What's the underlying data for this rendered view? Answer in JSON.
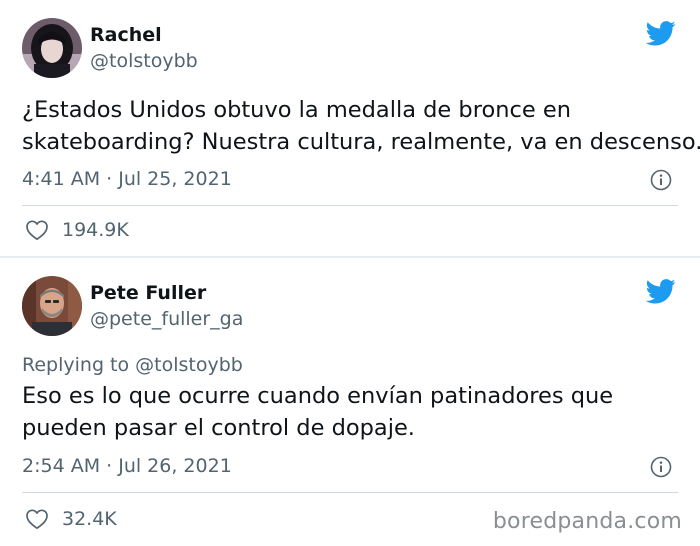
{
  "tweets": [
    {
      "name": "Rachel",
      "handle": "@tolstoybb",
      "lines": [
        "¿Estados Unidos obtuvo la medalla de bronce en",
        "skateboarding? Nuestra cultura, realmente, va en descenso."
      ],
      "timestamp": "4:41 AM · Jul 25, 2021",
      "likes": "194.9K",
      "icons": {
        "avatar": "avatar-photo",
        "brand": "twitter-bird-icon",
        "info": "info-icon",
        "like": "heart-icon"
      }
    },
    {
      "name": "Pete Fuller",
      "handle": "@pete_fuller_ga",
      "replying_prefix": "Replying to",
      "replying_to": "@tolstoybb",
      "lines": [
        "Eso es lo que ocurre cuando envían patinadores que",
        "pueden pasar el control de dopaje."
      ],
      "timestamp": "2:54 AM · Jul 26, 2021",
      "likes": "32.4K",
      "icons": {
        "avatar": "avatar-photo",
        "brand": "twitter-bird-icon",
        "info": "info-icon",
        "like": "heart-icon"
      }
    }
  ],
  "watermark": "boredpanda.com",
  "colors": {
    "twitter_blue": "#1d9bf0",
    "secondary_text": "#536471",
    "primary_text": "#0f1419"
  }
}
